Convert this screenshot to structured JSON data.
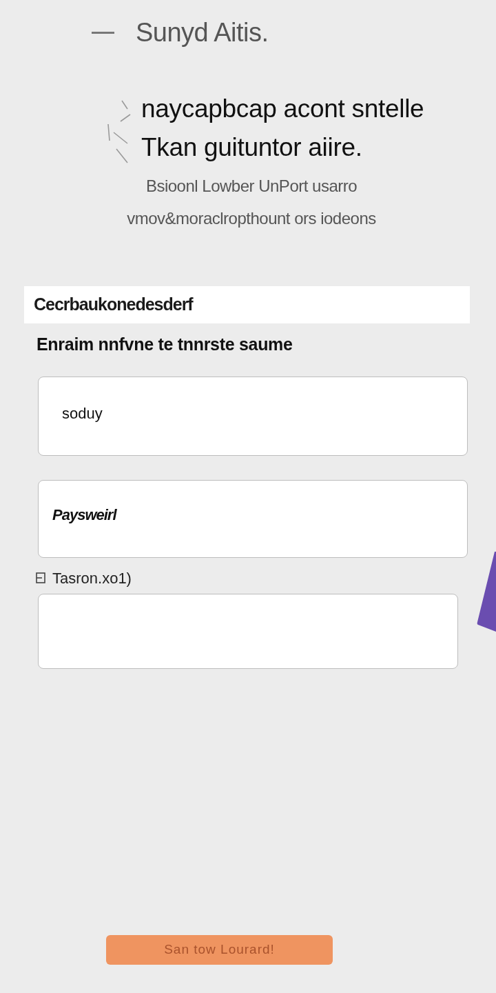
{
  "header": {
    "title": "Sunyd Aitis."
  },
  "hero": {
    "headline": [
      "naycapbcap acont sntelle",
      "Tkan guituntor aiire."
    ],
    "subtitle": [
      "Bsioonl Lowber UnPort usarro",
      "vmov&moraclropthount ors iodeons"
    ]
  },
  "banner": {
    "text": "Cecrbaukonedesderf"
  },
  "form": {
    "heading": "Enraim nnfvne te tnnrste saume",
    "fields": [
      {
        "kind": "plain",
        "value": "soduy"
      },
      {
        "kind": "bold",
        "value": "Paysweirl"
      },
      {
        "kind": "labeled",
        "label": "Tasron.xo1)"
      }
    ]
  },
  "button": {
    "label": "San tow Lourard!"
  }
}
